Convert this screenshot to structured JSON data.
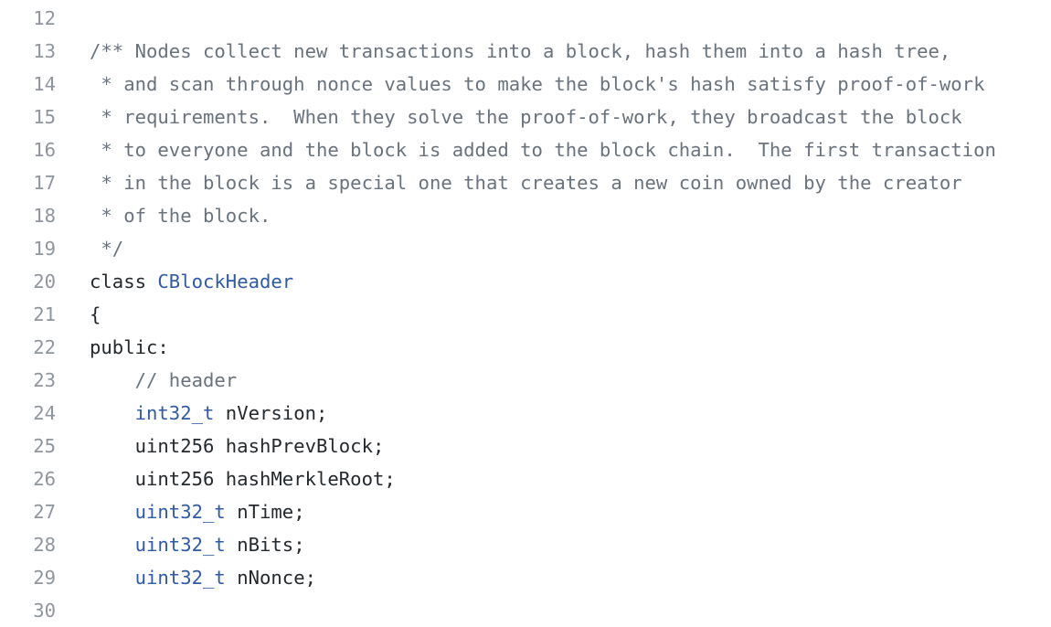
{
  "colors": {
    "background": "#ffffff",
    "line_number": "#8f959c",
    "comment": "#6a737d",
    "type": "#2f5aa8",
    "text": "#24292e"
  },
  "lines": [
    {
      "number": "12",
      "tokens": []
    },
    {
      "number": "13",
      "tokens": [
        {
          "kind": "comment",
          "text": "/** Nodes collect new transactions into a block, hash them into a hash tree,"
        }
      ]
    },
    {
      "number": "14",
      "tokens": [
        {
          "kind": "comment",
          "text": " * and scan through nonce values to make the block's hash satisfy proof-of-work"
        }
      ]
    },
    {
      "number": "15",
      "tokens": [
        {
          "kind": "comment",
          "text": " * requirements.  When they solve the proof-of-work, they broadcast the block"
        }
      ]
    },
    {
      "number": "16",
      "tokens": [
        {
          "kind": "comment",
          "text": " * to everyone and the block is added to the block chain.  The first transaction"
        }
      ]
    },
    {
      "number": "17",
      "tokens": [
        {
          "kind": "comment",
          "text": " * in the block is a special one that creates a new coin owned by the creator"
        }
      ]
    },
    {
      "number": "18",
      "tokens": [
        {
          "kind": "comment",
          "text": " * of the block."
        }
      ]
    },
    {
      "number": "19",
      "tokens": [
        {
          "kind": "comment",
          "text": " */"
        }
      ]
    },
    {
      "number": "20",
      "tokens": [
        {
          "kind": "text",
          "text": "class "
        },
        {
          "kind": "type",
          "text": "CBlockHeader"
        }
      ]
    },
    {
      "number": "21",
      "tokens": [
        {
          "kind": "text",
          "text": "{"
        }
      ]
    },
    {
      "number": "22",
      "tokens": [
        {
          "kind": "text",
          "text": "public:"
        }
      ]
    },
    {
      "number": "23",
      "tokens": [
        {
          "kind": "comment",
          "text": "    // header"
        }
      ]
    },
    {
      "number": "24",
      "tokens": [
        {
          "kind": "text",
          "text": "    "
        },
        {
          "kind": "type",
          "text": "int32_t"
        },
        {
          "kind": "text",
          "text": " nVersion;"
        }
      ]
    },
    {
      "number": "25",
      "tokens": [
        {
          "kind": "text",
          "text": "    uint256 hashPrevBlock;"
        }
      ]
    },
    {
      "number": "26",
      "tokens": [
        {
          "kind": "text",
          "text": "    uint256 hashMerkleRoot;"
        }
      ]
    },
    {
      "number": "27",
      "tokens": [
        {
          "kind": "text",
          "text": "    "
        },
        {
          "kind": "type",
          "text": "uint32_t"
        },
        {
          "kind": "text",
          "text": " nTime;"
        }
      ]
    },
    {
      "number": "28",
      "tokens": [
        {
          "kind": "text",
          "text": "    "
        },
        {
          "kind": "type",
          "text": "uint32_t"
        },
        {
          "kind": "text",
          "text": " nBits;"
        }
      ]
    },
    {
      "number": "29",
      "tokens": [
        {
          "kind": "text",
          "text": "    "
        },
        {
          "kind": "type",
          "text": "uint32_t"
        },
        {
          "kind": "text",
          "text": " nNonce;"
        }
      ]
    },
    {
      "number": "30",
      "tokens": []
    }
  ]
}
